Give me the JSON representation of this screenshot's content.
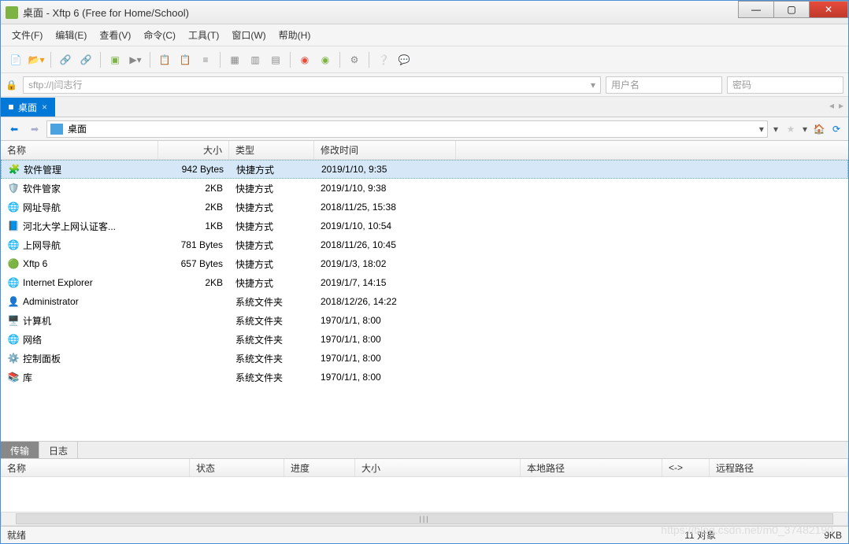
{
  "window": {
    "title": "桌面 - Xftp 6 (Free for Home/School)"
  },
  "menu": [
    "文件(F)",
    "编辑(E)",
    "查看(V)",
    "命令(C)",
    "工具(T)",
    "窗口(W)",
    "帮助(H)"
  ],
  "address": {
    "url": "sftp://|闫志行",
    "user_ph": "用户名",
    "pass_ph": "密码"
  },
  "tab": {
    "label": "桌面"
  },
  "path": {
    "text": "桌面"
  },
  "columns": {
    "name": "名称",
    "size": "大小",
    "type": "类型",
    "time": "修改时间"
  },
  "rows": [
    {
      "icon": "🧩",
      "name": "软件管理",
      "size": "942 Bytes",
      "type": "快捷方式",
      "time": "2019/1/10, 9:35",
      "selected": true
    },
    {
      "icon": "🛡️",
      "name": "软件管家",
      "size": "2KB",
      "type": "快捷方式",
      "time": "2019/1/10, 9:38"
    },
    {
      "icon": "🌐",
      "name": "网址导航",
      "size": "2KB",
      "type": "快捷方式",
      "time": "2018/11/25, 15:38"
    },
    {
      "icon": "📘",
      "name": "河北大学上网认证客...",
      "size": "1KB",
      "type": "快捷方式",
      "time": "2019/1/10, 10:54"
    },
    {
      "icon": "🌐",
      "name": "上网导航",
      "size": "781 Bytes",
      "type": "快捷方式",
      "time": "2018/11/26, 10:45"
    },
    {
      "icon": "🟢",
      "name": "Xftp 6",
      "size": "657 Bytes",
      "type": "快捷方式",
      "time": "2019/1/3, 18:02"
    },
    {
      "icon": "🌐",
      "name": "Internet Explorer",
      "size": "2KB",
      "type": "快捷方式",
      "time": "2019/1/7, 14:15"
    },
    {
      "icon": "👤",
      "name": "Administrator",
      "size": "",
      "type": "系统文件夹",
      "time": "2018/12/26, 14:22"
    },
    {
      "icon": "🖥️",
      "name": "计算机",
      "size": "",
      "type": "系统文件夹",
      "time": "1970/1/1, 8:00"
    },
    {
      "icon": "🌐",
      "name": "网络",
      "size": "",
      "type": "系统文件夹",
      "time": "1970/1/1, 8:00"
    },
    {
      "icon": "⚙️",
      "name": "控制面板",
      "size": "",
      "type": "系统文件夹",
      "time": "1970/1/1, 8:00"
    },
    {
      "icon": "📚",
      "name": "库",
      "size": "",
      "type": "系统文件夹",
      "time": "1970/1/1, 8:00"
    }
  ],
  "bottom_tabs": {
    "transfer": "传输",
    "log": "日志"
  },
  "transfer_cols": {
    "name": "名称",
    "status": "状态",
    "progress": "进度",
    "size": "大小",
    "local": "本地路径",
    "dir": "<->",
    "remote": "远程路径"
  },
  "status": {
    "ready": "就绪",
    "objects": "11 对象",
    "size": "9KB"
  },
  "watermark": "https://blog.csdn.net/m0_37482190"
}
